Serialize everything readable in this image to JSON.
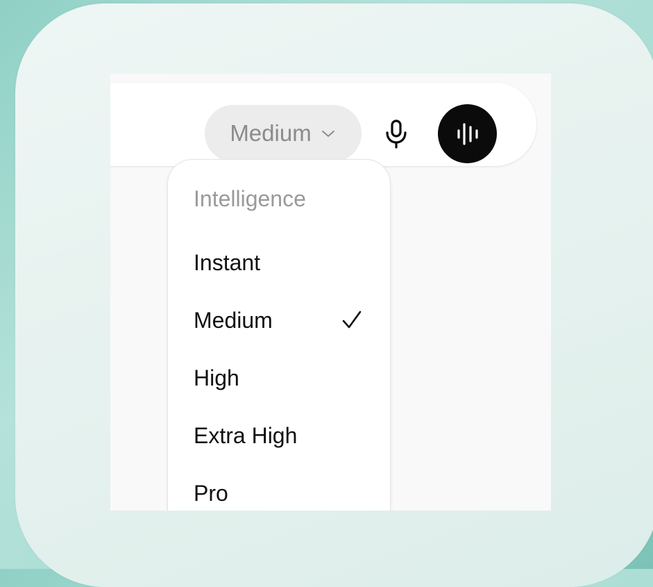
{
  "composer": {
    "model_selector_label": "Medium",
    "mic_icon": "microphone-icon",
    "voice_icon": "voice-waveform-icon"
  },
  "menu": {
    "header": "Intelligence",
    "items": [
      {
        "label": "Instant",
        "selected": false
      },
      {
        "label": "Medium",
        "selected": true
      },
      {
        "label": "High",
        "selected": false
      },
      {
        "label": "Extra High",
        "selected": false
      },
      {
        "label": "Pro",
        "selected": false
      }
    ],
    "check_icon": "checkmark-icon"
  },
  "colors": {
    "background": "#a7dcd2",
    "card": "#e6f2ef",
    "pill": "#ececec",
    "voice_button": "#0b0b0b"
  }
}
